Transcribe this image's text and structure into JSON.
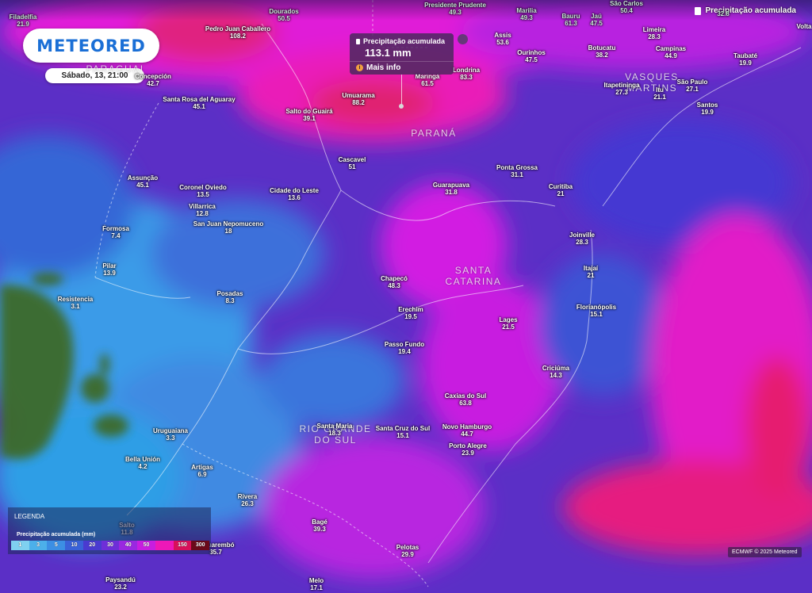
{
  "header": {
    "layer_title": "Precipitação acumulada",
    "layer_icon": "document-icon"
  },
  "logo": {
    "text": "METEORED"
  },
  "forecast_time": "Sábado, 13, 21:00",
  "tooltip": {
    "title": "Precipitação acumulada",
    "value": "113.1 mm",
    "more_info": "Mais info",
    "info_icon": "info-icon"
  },
  "legend": {
    "title": "LEGENDA",
    "subtitle": "Precipitação acumulada (mm)",
    "steps": [
      {
        "label": "1",
        "color": "#7fd0f0"
      },
      {
        "label": "3",
        "color": "#4cb0ea"
      },
      {
        "label": "5",
        "color": "#3c8fe4"
      },
      {
        "label": "10",
        "color": "#3a62d8"
      },
      {
        "label": "20",
        "color": "#4a3ad0"
      },
      {
        "label": "30",
        "color": "#6e2ed8"
      },
      {
        "label": "40",
        "color": "#9a28e0"
      },
      {
        "label": "50",
        "color": "#c81ee0"
      },
      {
        "label": "",
        "color": "#ee18b8"
      },
      {
        "label": "150",
        "color": "#d8105a"
      },
      {
        "label": "300",
        "color": "#6a0a1a"
      }
    ]
  },
  "credit": "ECMWF © 2025 Meteored",
  "regions": [
    {
      "label": "PARAGUAI"
    },
    {
      "label": "PARANÁ"
    },
    {
      "label": "SANTA\nCATARINA"
    },
    {
      "label": "RIO GRANDE\nDO SUL"
    },
    {
      "label": "VASQUES\nMARTINS"
    }
  ],
  "cities": [
    {
      "name": "Filadelfia",
      "value": "21.9",
      "muted": true
    },
    {
      "name": "Dourados",
      "value": "50.5",
      "muted": true
    },
    {
      "name": "Presidente Prudente",
      "value": "49.3",
      "muted": true
    },
    {
      "name": "Marilia",
      "value": "49.3",
      "muted": true
    },
    {
      "name": "Bauru",
      "value": "61.3",
      "muted": true
    },
    {
      "name": "Jaú",
      "value": "47.5",
      "muted": true
    },
    {
      "name": "São Carlos",
      "value": "50.4",
      "muted": true
    },
    {
      "name": "",
      "value": "32.8",
      "muted": true
    },
    {
      "name": "Volta",
      "value": "",
      "muted": false
    },
    {
      "name": "Pedro Juan Caballero",
      "value": "108.2"
    },
    {
      "name": "Assis",
      "value": "53.6"
    },
    {
      "name": "Ourinhos",
      "value": "47.5"
    },
    {
      "name": "Botucatu",
      "value": "38.2"
    },
    {
      "name": "Limeira",
      "value": "28.3"
    },
    {
      "name": "Campinas",
      "value": "44.9"
    },
    {
      "name": "Taubaté",
      "value": "19.9"
    },
    {
      "name": "Concepción",
      "value": "42.7"
    },
    {
      "name": "Londrina",
      "value": "83.3"
    },
    {
      "name": "Maringá",
      "value": "61.5"
    },
    {
      "name": "Itapetininga",
      "value": "27.3"
    },
    {
      "name": "Itu",
      "value": "21.1"
    },
    {
      "name": "São Paulo",
      "value": "27.1"
    },
    {
      "name": "Umuarama",
      "value": "88.2"
    },
    {
      "name": "Santa Rosa del Aguaray",
      "value": "45.1"
    },
    {
      "name": "Salto do Guairá",
      "value": "39.1"
    },
    {
      "name": "Santos",
      "value": "19.9"
    },
    {
      "name": "Cascavel",
      "value": "51"
    },
    {
      "name": "Ponta Grossa",
      "value": "31.1"
    },
    {
      "name": "Assunção",
      "value": "45.1"
    },
    {
      "name": "Guarapuava",
      "value": "31.8"
    },
    {
      "name": "Curitiba",
      "value": "21"
    },
    {
      "name": "Coronel Oviedo",
      "value": "13.5"
    },
    {
      "name": "Cidade do Leste",
      "value": "13.6"
    },
    {
      "name": "Villarrica",
      "value": "12.8"
    },
    {
      "name": "San Juan Nepomuceno",
      "value": "18"
    },
    {
      "name": "Formosa",
      "value": "7.4"
    },
    {
      "name": "Joinville",
      "value": "28.3"
    },
    {
      "name": "Pilar",
      "value": "13.9"
    },
    {
      "name": "Itajaí",
      "value": "21"
    },
    {
      "name": "Chapecó",
      "value": "48.3"
    },
    {
      "name": "Posadas",
      "value": "8.3"
    },
    {
      "name": "Resistencia",
      "value": "3.1"
    },
    {
      "name": "Florianópolis",
      "value": "15.1"
    },
    {
      "name": "Erechim",
      "value": "19.5"
    },
    {
      "name": "Lages",
      "value": "21.5"
    },
    {
      "name": "Passo Fundo",
      "value": "19.4"
    },
    {
      "name": "Criciúma",
      "value": "14.3"
    },
    {
      "name": "Caxias do Sul",
      "value": "63.8"
    },
    {
      "name": "Santa Maria",
      "value": "18.3"
    },
    {
      "name": "Santa Cruz do Sul",
      "value": "15.1"
    },
    {
      "name": "Novo Hamburgo",
      "value": "44.7"
    },
    {
      "name": "Uruguaiana",
      "value": "3.3"
    },
    {
      "name": "Porto Alegre",
      "value": "23.9"
    },
    {
      "name": "Bella Unión",
      "value": "4.2"
    },
    {
      "name": "Artigas",
      "value": "6.9"
    },
    {
      "name": "Rivera",
      "value": "26.3"
    },
    {
      "name": "Bagé",
      "value": "39.3"
    },
    {
      "name": "Salto",
      "value": "11.8"
    },
    {
      "name": "Tacuarembó",
      "value": "35.7"
    },
    {
      "name": "Pelotas",
      "value": "29.9"
    },
    {
      "name": "Paysandú",
      "value": "23.2"
    },
    {
      "name": "Melo",
      "value": "17.1"
    }
  ]
}
